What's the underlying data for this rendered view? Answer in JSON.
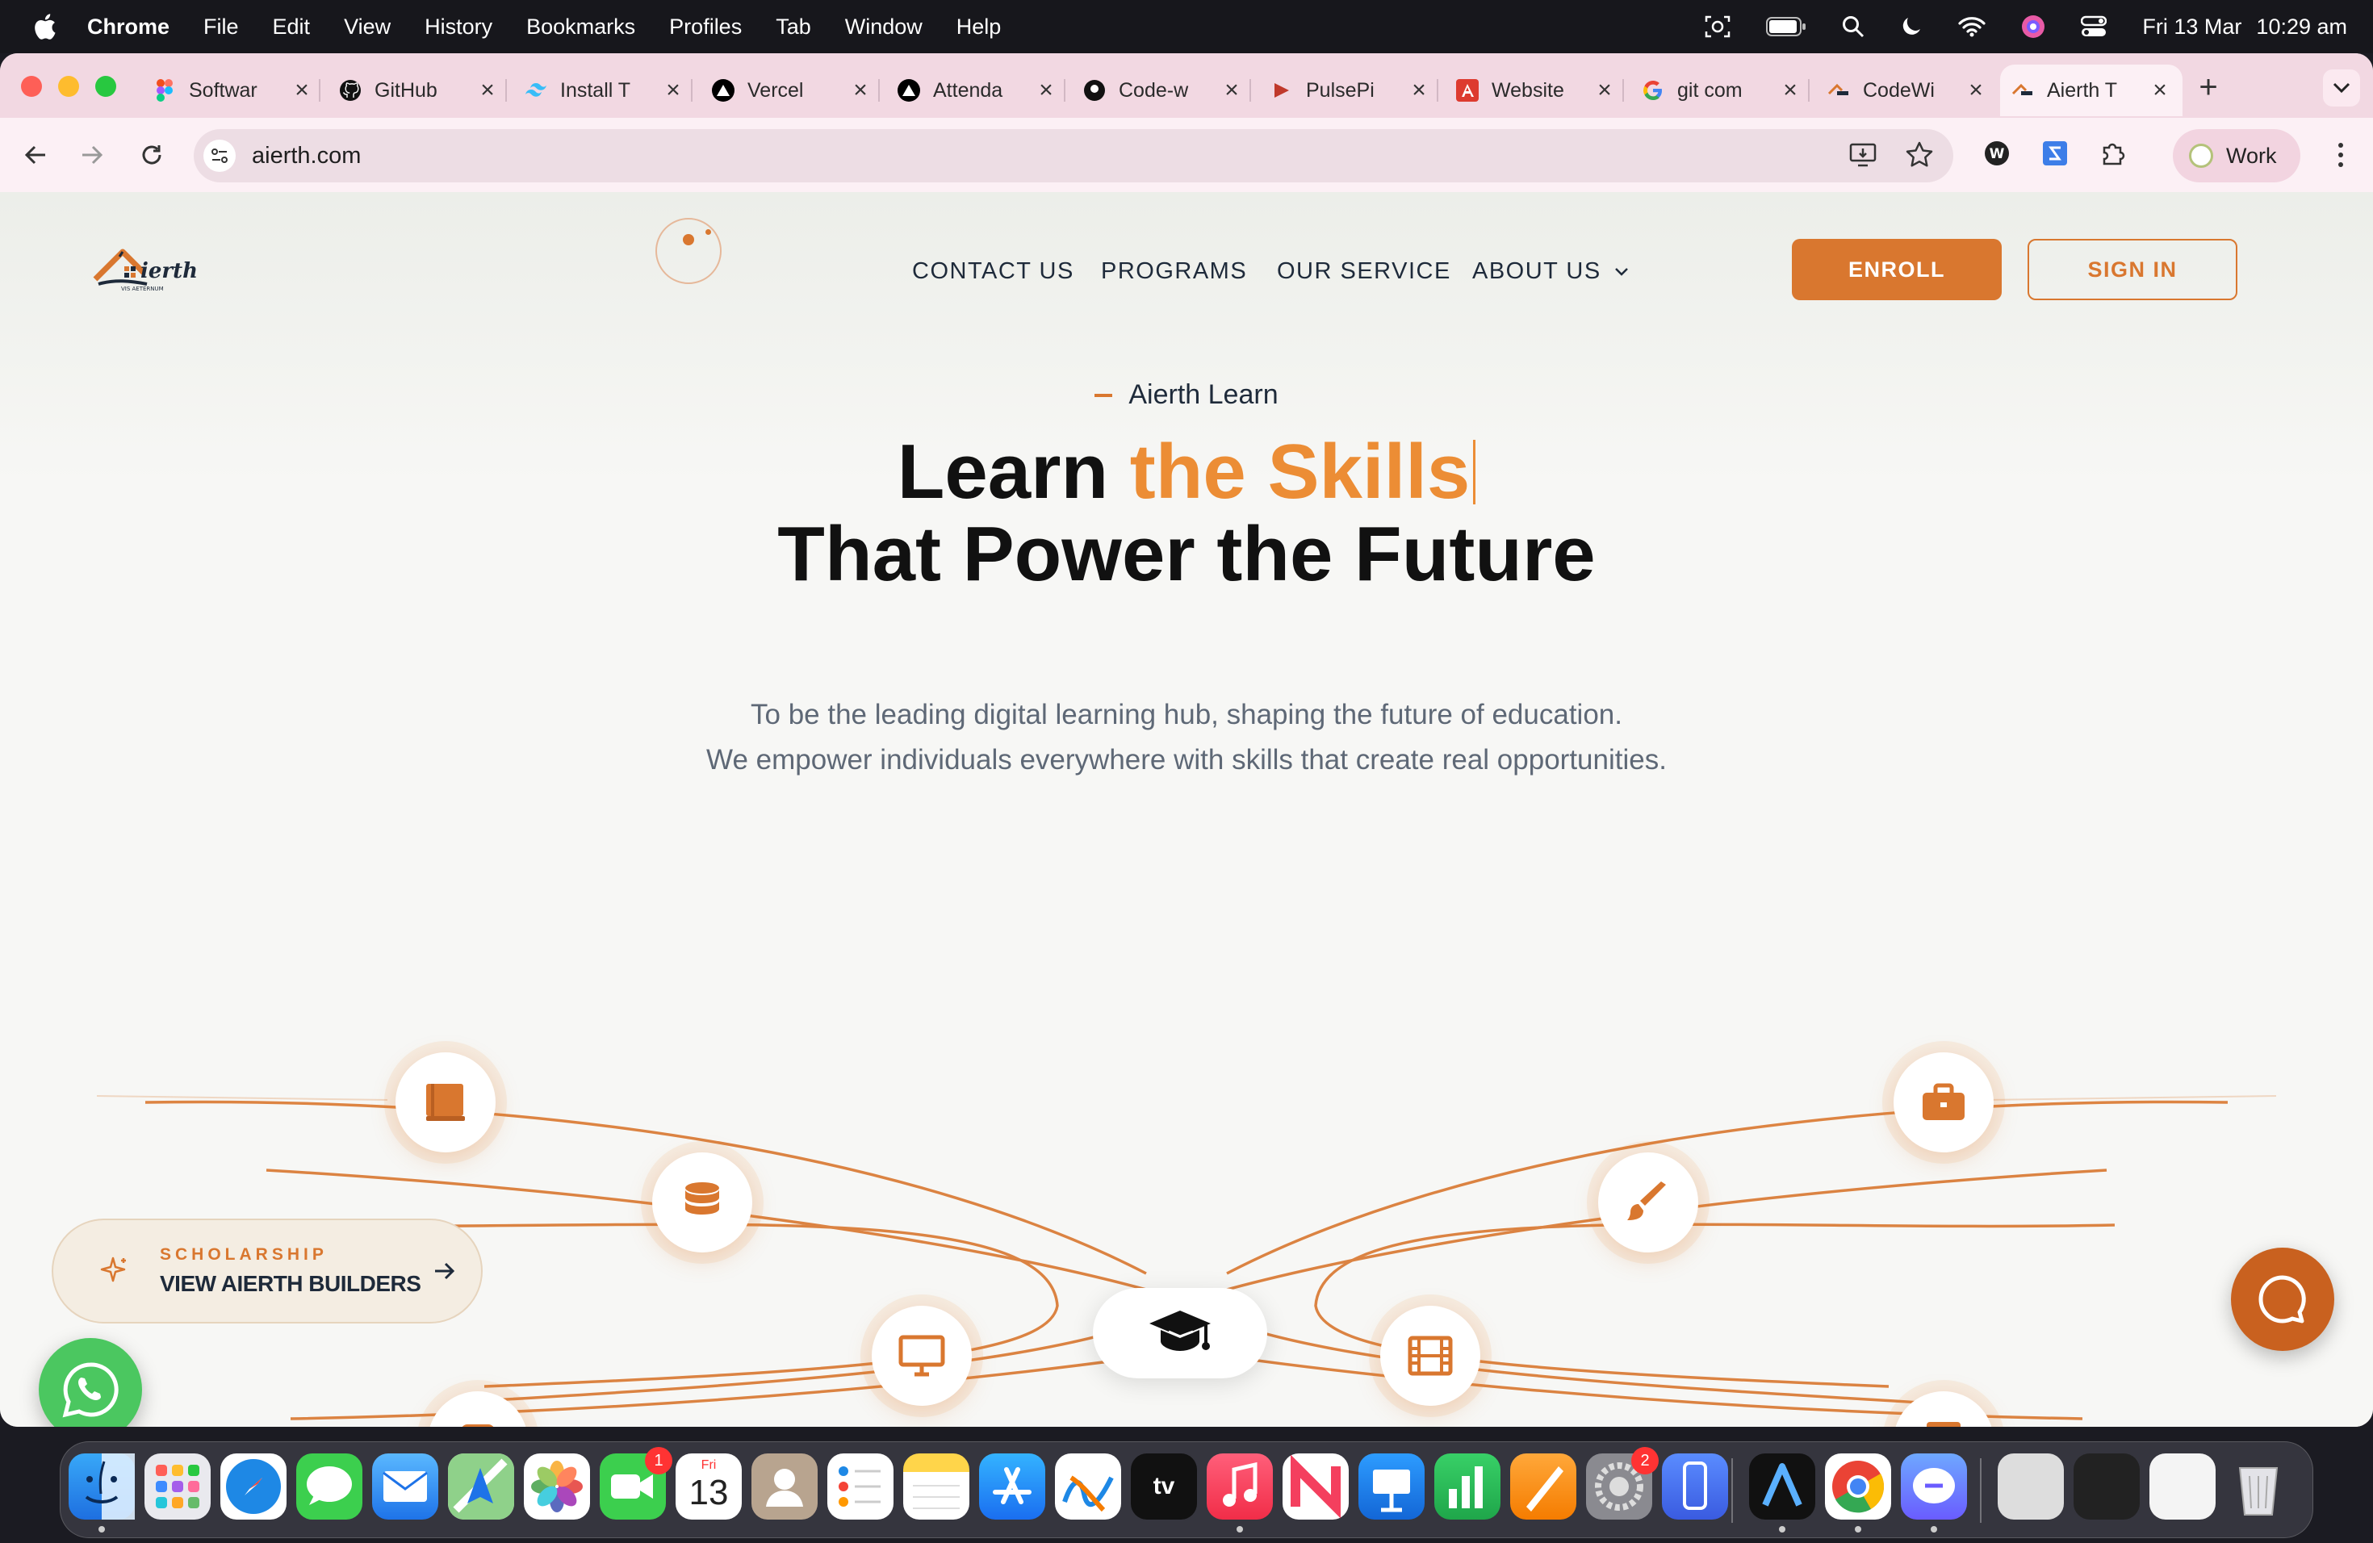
{
  "menubar": {
    "app_name": "Chrome",
    "menus": [
      "File",
      "Edit",
      "View",
      "History",
      "Bookmarks",
      "Profiles",
      "Tab",
      "Window",
      "Help"
    ],
    "date": "Fri 13 Mar",
    "time": "10:29 am"
  },
  "tabs": [
    {
      "title": "Softwar",
      "icon": "figma-icon",
      "color": "#a259ff"
    },
    {
      "title": "GitHub",
      "icon": "github-icon",
      "color": "#111111"
    },
    {
      "title": "Install T",
      "icon": "tailwind-icon",
      "color": "#38bdf8"
    },
    {
      "title": "Vercel",
      "icon": "vercel-icon",
      "color": "#000000"
    },
    {
      "title": "Attenda",
      "icon": "vercel-icon",
      "color": "#000000"
    },
    {
      "title": "Code-w",
      "icon": "github-icon",
      "color": "#111111"
    },
    {
      "title": "PulsePi",
      "icon": "pulse-icon",
      "color": "#c0392b"
    },
    {
      "title": "Website",
      "icon": "angular-icon",
      "color": "#dd3b2f"
    },
    {
      "title": "git com",
      "icon": "google-icon",
      "color": "#4285f4"
    },
    {
      "title": "CodeWi",
      "icon": "aierth-icon",
      "color": "#d9772f"
    },
    {
      "title": "Aierth T",
      "icon": "aierth-icon",
      "color": "#d9772f",
      "active": true
    }
  ],
  "toolbar": {
    "url": "aierth.com",
    "profile_label": "Work"
  },
  "page": {
    "logo_text": "ierth",
    "logo_sub": "VIS AETERNUM",
    "nav": {
      "contact": "CONTACT US",
      "programs": "PROGRAMS",
      "service": "OUR SERVICE",
      "about": "ABOUT US"
    },
    "enroll_label": "ENROLL",
    "signin_label": "SIGN IN",
    "eyebrow": "Aierth Learn",
    "hero": {
      "line1_plain": "Learn ",
      "line1_accent": "the Skills",
      "line2": "That Power the Future"
    },
    "description": {
      "line1": "To be the leading digital learning hub, shaping the future of education.",
      "line2": "We empower individuals everywhere with skills that create real opportunities."
    },
    "scholarship": {
      "kicker": "SCHOLARSHIP",
      "title": "VIEW AIERTH BUILDERS"
    },
    "nodes": [
      "book-icon",
      "database-icon",
      "monitor-icon",
      "language-icon",
      "presentation-icon",
      "briefcase-icon",
      "brush-icon",
      "film-icon",
      "notebook-icon",
      "user-icon"
    ],
    "hub_icon": "graduation-cap-icon",
    "colors": {
      "accent": "#d9772f",
      "accent_light": "#ec8d35",
      "dark": "#1e2a3a"
    }
  },
  "dock": {
    "facetime_badge": "1",
    "calendar_month": "Fri",
    "calendar_day": "13",
    "settings_badge": "2",
    "tv_label": "tv"
  }
}
